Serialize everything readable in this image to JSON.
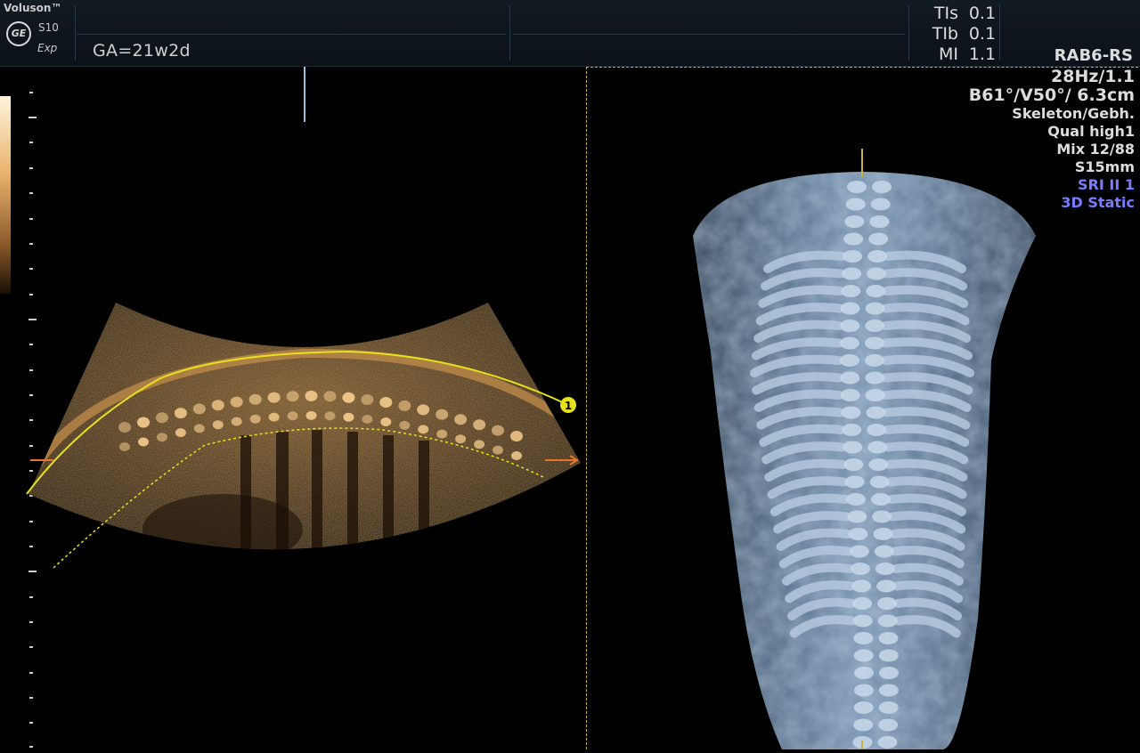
{
  "header": {
    "brand": "Voluson™",
    "brand_logo": "GE",
    "model": "S10",
    "model_sub": "Exp",
    "ga": "GA=21w2d",
    "indices": [
      {
        "label": "TIs",
        "value": "0.1"
      },
      {
        "label": "TIb",
        "value": "0.1"
      },
      {
        "label": "MI",
        "value": "1.1"
      }
    ],
    "probe": "RAB6-RS"
  },
  "info_panel": {
    "frame_rate": "28Hz/1.1",
    "angles": "B61°/V50°/ 6.3cm",
    "preset": "Skeleton/Gebh.",
    "quality": "Qual high1",
    "mix": "Mix 12/88",
    "slice": "S15mm",
    "sri": "SRI II 1",
    "mode": "3D Static"
  },
  "colors": {
    "accent_text": "#7a7cff",
    "render_line": "#e6e21a",
    "roi_frame": "#c9b23a",
    "sepia": "#c8904a",
    "bone_blue": "#a8c0dc"
  },
  "render_marker": "1"
}
